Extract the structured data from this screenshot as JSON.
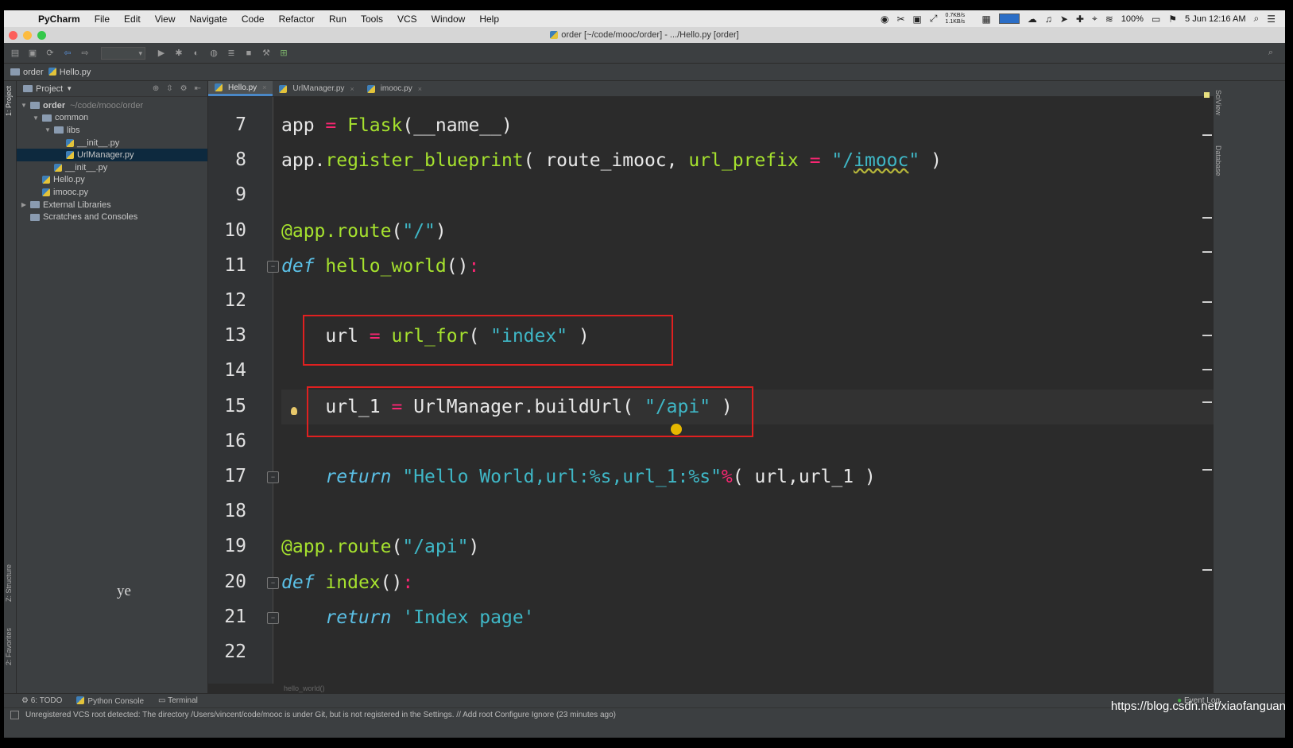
{
  "menubar": {
    "items": [
      "PyCharm",
      "File",
      "Edit",
      "View",
      "Navigate",
      "Code",
      "Refactor",
      "Run",
      "Tools",
      "VCS",
      "Window",
      "Help"
    ],
    "net_speed": "0.7KB/s 1.1KB/s",
    "battery": "100%",
    "datetime": "5 Jun  12:16 AM"
  },
  "window": {
    "title": "order [~/code/mooc/order] - .../Hello.py [order]"
  },
  "navbar": {
    "project": "order",
    "file": "Hello.py"
  },
  "project_panel": {
    "title": "Project",
    "tree": [
      {
        "label": "order",
        "path": "~/code/mooc/order",
        "type": "folder",
        "level": 0,
        "expanded": true,
        "bold": true
      },
      {
        "label": "common",
        "type": "folder",
        "level": 1,
        "expanded": true
      },
      {
        "label": "libs",
        "type": "folder",
        "level": 2,
        "expanded": true
      },
      {
        "label": "__init__.py",
        "type": "file",
        "level": 3
      },
      {
        "label": "UrlManager.py",
        "type": "file",
        "level": 3,
        "selected": true
      },
      {
        "label": "__init__.py",
        "type": "file",
        "level": 2
      },
      {
        "label": "Hello.py",
        "type": "file",
        "level": 1
      },
      {
        "label": "imooc.py",
        "type": "file",
        "level": 1
      },
      {
        "label": "External Libraries",
        "type": "lib",
        "level": 0,
        "expanded": false
      },
      {
        "label": "Scratches and Consoles",
        "type": "scratch",
        "level": 0
      }
    ],
    "overlay_text": "ye"
  },
  "left_tool_tabs": {
    "project": "1: Project",
    "structure": "Z: Structure",
    "favorites": "2: Favorites"
  },
  "right_tool_tabs": {
    "sciview": "SciView",
    "database": "Database"
  },
  "editor": {
    "tabs": [
      {
        "label": "Hello.py",
        "active": true
      },
      {
        "label": "UrlManager.py",
        "active": false
      },
      {
        "label": "imooc.py",
        "active": false
      }
    ],
    "lines": [
      {
        "num": "7",
        "html": "app <span class=\"op\">=</span> <span class=\"fn\">Flask</span>(__name__)"
      },
      {
        "num": "8",
        "html": "app.<span class=\"fn\">register_blueprint</span>( route_imooc, <span class=\"param\">url_prefix</span> <span class=\"op\">=</span> <span class=\"str\">\"/<span class=\"squig\">imooc</span>\"</span> )"
      },
      {
        "num": "9",
        "html": ""
      },
      {
        "num": "10",
        "html": "<span class=\"dec\">@app.route</span>(<span class=\"str\">\"/\"</span>)"
      },
      {
        "num": "11",
        "html": "<span class=\"kw\">def</span> <span class=\"fn\">hello_world</span>()<span class=\"op\">:</span>"
      },
      {
        "num": "12",
        "html": ""
      },
      {
        "num": "13",
        "html": "    url <span class=\"op\">=</span> <span class=\"fn\">url_for</span>( <span class=\"str\">\"index\"</span> )"
      },
      {
        "num": "14",
        "html": ""
      },
      {
        "num": "15",
        "html": "    url_1 <span class=\"op\">=</span> UrlManager.buildUrl( <span class=\"str\">\"/api\"</span> )"
      },
      {
        "num": "16",
        "html": ""
      },
      {
        "num": "17",
        "html": "    <span class=\"kw\">return</span> <span class=\"str\">\"Hello World,url:%s,url_1:%s\"</span><span class=\"op\">%</span>( url,url_1 )"
      },
      {
        "num": "18",
        "html": ""
      },
      {
        "num": "19",
        "html": "<span class=\"dec\">@app.route</span>(<span class=\"str\">\"/api\"</span>)"
      },
      {
        "num": "20",
        "html": "<span class=\"kw\">def</span> <span class=\"fn\">index</span>()<span class=\"op\">:</span>"
      },
      {
        "num": "21",
        "html": "    <span class=\"kw\">return</span> <span class=\"str\">'Index page'</span>"
      },
      {
        "num": "22",
        "html": ""
      }
    ],
    "breadcrumb": "hello_world()"
  },
  "bottom_tabs": {
    "todo": "6: TODO",
    "python_console": "Python Console",
    "terminal": "Terminal",
    "event_log": "Event Log"
  },
  "status": {
    "message": "Unregistered VCS root detected: The directory /Users/vincent/code/mooc is under Git, but is not registered in the Settings. // Add root  Configure  Ignore (23 minutes ago)"
  },
  "watermark": "https://blog.csdn.net/xiaofanguan",
  "colors": {
    "background": "#2b2b2b",
    "highlight_box": "#e02020",
    "keyword": "#5bc0e6",
    "function": "#a6e22e",
    "string": "#3fb7c6",
    "operator": "#f92672"
  }
}
